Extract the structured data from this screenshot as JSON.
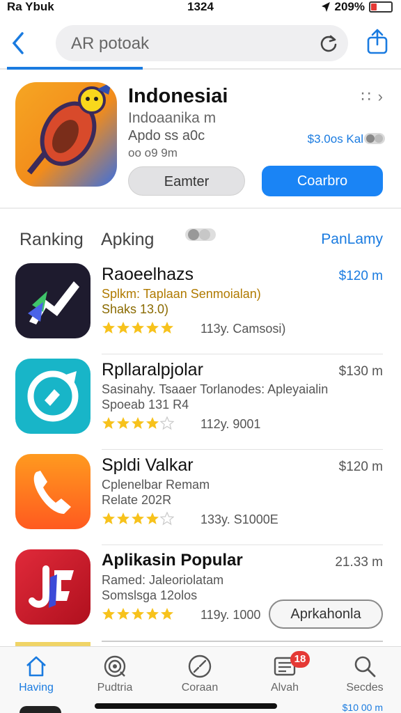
{
  "status": {
    "carrier": "Ra Ybuk",
    "time": "1324",
    "battery": "209%"
  },
  "nav": {
    "url_text": "AR potoak"
  },
  "featured": {
    "title": "Indonesiai",
    "subtitle": "Indoaanika m",
    "meta1": "Apdo ss a0c",
    "meta2": "oo o9 9m",
    "price": "$3.0os Kal",
    "secondary_btn": "Eamter",
    "primary_btn": "Coarbro"
  },
  "tabs": {
    "ranking": "Ranking",
    "apking": "Apking",
    "right": "PanLamy"
  },
  "apps": [
    {
      "name": "Raoeelhazs",
      "line1": "Splkm: Taplaan Senmoialan)",
      "line2": "Shaks 13.0)",
      "rating": "113y.  Camsosi)",
      "price": "$120 m",
      "stars": 5,
      "price_blue": true
    },
    {
      "name": "Rpllaralpjolar",
      "line1": "Sasinahy. Tsaaer Torlanodes: Apleyaialin",
      "line2": "Spoeab 131 R4",
      "rating": "112y.  9001",
      "price": "$130 m",
      "stars": 4,
      "price_blue": false
    },
    {
      "name": "Spldi Valkar",
      "line1": "Cplenelbar Remam",
      "line2": "Relate 202R",
      "rating": "133y.  S1000E",
      "price": "$120 m",
      "stars": 4,
      "price_blue": false
    },
    {
      "name": "Aplikasin Popular",
      "line1": "Ramed: Jaleoriolatam",
      "line2": "Somslsga 12olos",
      "rating": "119y.  1000",
      "price": "21.33 m",
      "stars": 5,
      "price_blue": false,
      "button": "Aprkahonla"
    }
  ],
  "tabbar": {
    "items": [
      {
        "label": "Having",
        "icon": "home-icon"
      },
      {
        "label": "Pudtria",
        "icon": "target-icon"
      },
      {
        "label": "Coraan",
        "icon": "gauge-icon"
      },
      {
        "label": "Alvah",
        "icon": "list-icon",
        "badge": "18"
      },
      {
        "label": "Secdes",
        "icon": "search-icon"
      }
    ]
  },
  "bottom_peek_price": "$10 00 m",
  "colors": {
    "accent": "#1a7be0",
    "primary_button": "#1a84f5",
    "star": "#f7c21c",
    "badge": "#e53935"
  }
}
